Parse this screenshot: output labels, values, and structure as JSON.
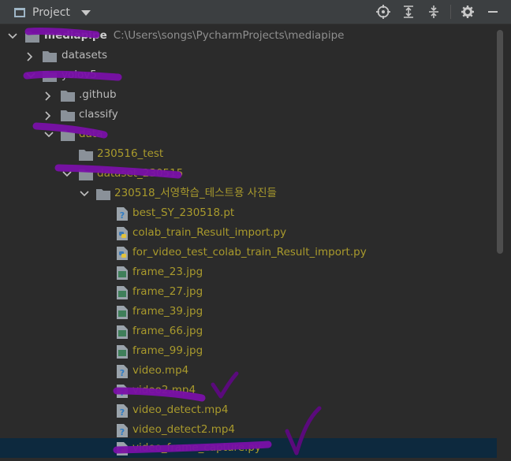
{
  "toolbar": {
    "title": "Project",
    "icons": [
      "locate-icon",
      "expand-all-icon",
      "collapse-all-icon",
      "gear-icon",
      "minimize-icon"
    ]
  },
  "tree": {
    "root": {
      "label": "mediapipe",
      "path": "C:\\Users\\songs\\PycharmProjects\\mediapipe"
    },
    "datasets": "datasets",
    "yolov5": "yolov5",
    "github": ".github",
    "classify": "classify",
    "data": "data",
    "test": "230516_test",
    "dataset": "dataset_230515",
    "photos": "230518_서영학습_테스트용 사진들",
    "files": [
      {
        "name": "best_SY_230518.pt",
        "icon": "unknown-file-icon"
      },
      {
        "name": "colab_train_Result_import.py",
        "icon": "python-file-icon"
      },
      {
        "name": "for_video_test_colab_train_Result_import.py",
        "icon": "python-file-icon"
      },
      {
        "name": "frame_23.jpg",
        "icon": "image-file-icon"
      },
      {
        "name": "frame_27.jpg",
        "icon": "image-file-icon"
      },
      {
        "name": "frame_39.jpg",
        "icon": "image-file-icon"
      },
      {
        "name": "frame_66.jpg",
        "icon": "image-file-icon"
      },
      {
        "name": "frame_99.jpg",
        "icon": "image-file-icon"
      },
      {
        "name": "video.mp4",
        "icon": "unknown-file-icon"
      },
      {
        "name": "video2.mp4",
        "icon": "unknown-file-icon"
      },
      {
        "name": "video_detect.mp4",
        "icon": "unknown-file-icon"
      },
      {
        "name": "video_detect2.mp4",
        "icon": "unknown-file-icon"
      },
      {
        "name": "video_frame_capture.py",
        "icon": "python-file-icon"
      }
    ]
  },
  "colors": {
    "background": "#2b2b2b",
    "toolbar": "#3c3f41",
    "excluded_text": "#a99a2c",
    "selection": "#0d293e",
    "marker": "#7a10a8"
  }
}
